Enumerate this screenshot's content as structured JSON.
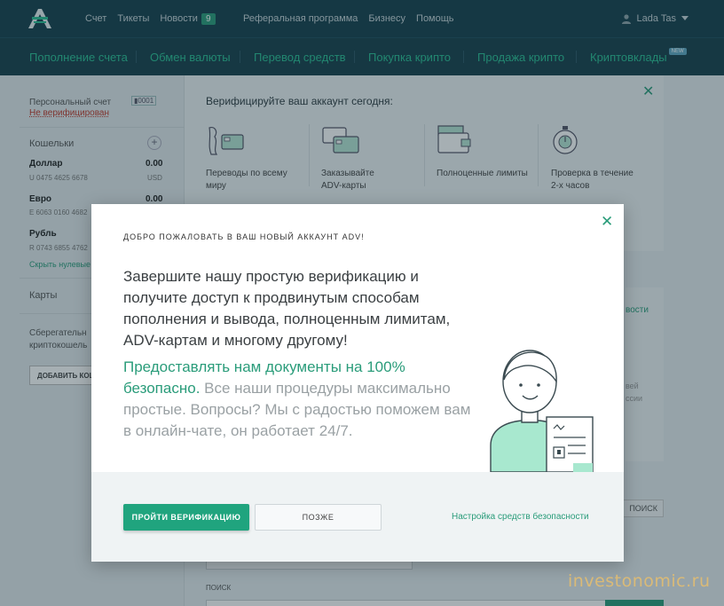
{
  "header": {
    "nav": [
      "Счет",
      "Тикеты",
      "Новости",
      "Реферальная программа",
      "Бизнесу",
      "Помощь"
    ],
    "news_badge": "9",
    "user_name": "Lada Tas"
  },
  "subnav": {
    "items": [
      "Пополнение счета",
      "Обмен валюты",
      "Перевод средств",
      "Покупка крипто",
      "Продажа крипто",
      "Криптовклады"
    ],
    "new_tag": "NEW"
  },
  "sidebar": {
    "personal_account_label": "Персональный счет",
    "account_chip": "0001",
    "verification_status": "Не верифицирован",
    "wallets_label": "Кошельки",
    "wallets": [
      {
        "name": "Доллар",
        "number": "U 0475 4625 6678",
        "balance": "0.00",
        "currency": "USD"
      },
      {
        "name": "Евро",
        "number": "E 6063 0160 4682",
        "balance": "0.00",
        "currency": ""
      },
      {
        "name": "Рубль",
        "number": "R 0743 6855 4762",
        "balance": "",
        "currency": ""
      }
    ],
    "hide_zero": "Скрыть нулевые",
    "cards_label": "Карты",
    "savings_label_1": "Сберегательн",
    "savings_label_2": "криптокошель",
    "add_button": "ДОБАВИТЬ КОШ"
  },
  "verify_banner": {
    "title": "Верифицируйте ваш аккаунт сегодня:",
    "features": [
      {
        "icon": "globe-card-icon",
        "line1": "Переводы по всему",
        "line2": "миру"
      },
      {
        "icon": "adv-card-icon",
        "line1": "Заказывайте",
        "line2": "ADV-карты"
      },
      {
        "icon": "wallet-limits-icon",
        "line1": "Полноценные лимиты",
        "line2": ""
      },
      {
        "icon": "stopwatch-icon",
        "line1": "Проверка в течение",
        "line2": "2-х часов"
      }
    ]
  },
  "right_card": {
    "link": "вости",
    "line1": "вей",
    "line2": "ссии"
  },
  "search": {
    "label": "ПОИСК",
    "button_fragment": "ПОИСК"
  },
  "modal": {
    "eyebrow": "ДОБРО ПОЖАЛОВАТЬ В ВАШ НОВЫЙ АККАУНТ ADV!",
    "text": "Завершите нашу простую верификацию и получите доступ к продвинутым способам пополнения и вывода, полноценным лимитам, ADV-картам и многому другому!",
    "highlight": "Предоставлять нам документы на 100% безопасно.",
    "text2": " Все наши процедуры максимально простые. Вопросы? Мы с радостью поможем вам в онлайн-чате, он работает 24/7.",
    "primary_button": "ПРОЙТИ ВЕРИФИКАЦИЮ",
    "secondary_button": "ПОЗЖЕ",
    "security_link": "Настройка средств безопасности"
  },
  "watermark": "investonomic.ru",
  "colors": {
    "header_bg": "#163f4c",
    "accent": "#20a47e",
    "link": "#2a9c7a"
  }
}
